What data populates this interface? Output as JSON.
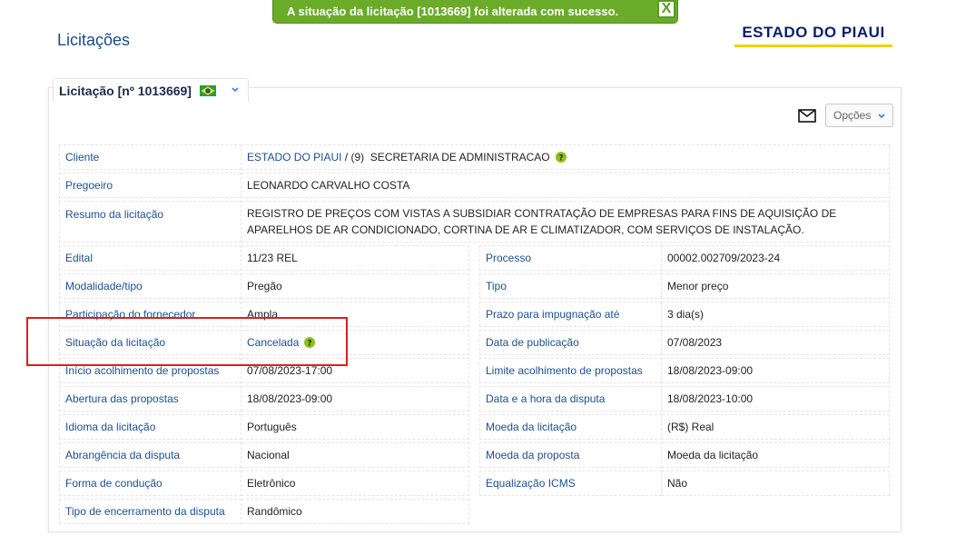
{
  "toast": {
    "message": "A situação da licitação [1013669] foi alterada com sucesso.",
    "close_label": "X"
  },
  "header": {
    "title": "Licitações",
    "brand": "ESTADO DO PIAUI"
  },
  "tab": {
    "label": "Licitação [nº 1013669]"
  },
  "toolbar": {
    "options_label": "Opções"
  },
  "details": {
    "cliente": {
      "label": "Cliente",
      "link": "ESTADO DO PIAUI",
      "rest": " / (9)  SECRETARIA DE ADMINISTRACAO"
    },
    "pregoeiro": {
      "label": "Pregoeiro",
      "value": "LEONARDO CARVALHO COSTA"
    },
    "resumo": {
      "label": "Resumo da licitação",
      "value": "REGISTRO DE PREÇOS COM VISTAS A SUBSIDIAR CONTRATAÇÃO DE EMPRESAS PARA FINS DE AQUISIÇÃO DE APARELHOS DE AR CONDICIONADO, CORTINA DE AR E CLIMATIZADOR, COM SERVIÇOS DE INSTALAÇÃO."
    },
    "left": [
      {
        "label": "Edital",
        "value": "11/23 REL"
      },
      {
        "label": "Modalidade/tipo",
        "value": "Pregão"
      },
      {
        "label": "Participação do fornecedor",
        "value": "Ampla"
      },
      {
        "label": "Situação da licitação",
        "value": "Cancelada"
      },
      {
        "label": "Início acolhimento de propostas",
        "value": "07/08/2023-17:00"
      },
      {
        "label": "Abertura das propostas",
        "value": "18/08/2023-09:00"
      },
      {
        "label": "Idioma da licitação",
        "value": "Português"
      },
      {
        "label": "Abrangência da disputa",
        "value": "Nacional"
      },
      {
        "label": "Forma de condução",
        "value": "Eletrônico"
      },
      {
        "label": "Tipo de encerramento da disputa",
        "value": "Randômico"
      }
    ],
    "right": [
      {
        "label": "Processo",
        "value": "00002.002709/2023-24"
      },
      {
        "label": "Tipo",
        "value": "Menor preço"
      },
      {
        "label": "Prazo para impugnação até",
        "value": "3 dia(s)"
      },
      {
        "label": "Data de publicação",
        "value": "07/08/2023"
      },
      {
        "label": "Limite acolhimento de propostas",
        "value": "18/08/2023-09:00"
      },
      {
        "label": "Data e a hora da disputa",
        "value": "18/08/2023-10:00"
      },
      {
        "label": "Moeda da licitação",
        "value": "(R$) Real"
      },
      {
        "label": "Moeda da proposta",
        "value": "Moeda da licitação"
      },
      {
        "label": "Equalização ICMS",
        "value": "Não"
      }
    ]
  },
  "colors": {
    "toast": "#6bab2a",
    "label": "#1d4f8f",
    "brand": "#0a1f6b",
    "brand_underline": "#f0d000",
    "highlight": "#e01e1e"
  },
  "icons": [
    "close-icon",
    "brazil-flag-icon",
    "chevron-down-icon",
    "mail-icon",
    "help-icon"
  ]
}
